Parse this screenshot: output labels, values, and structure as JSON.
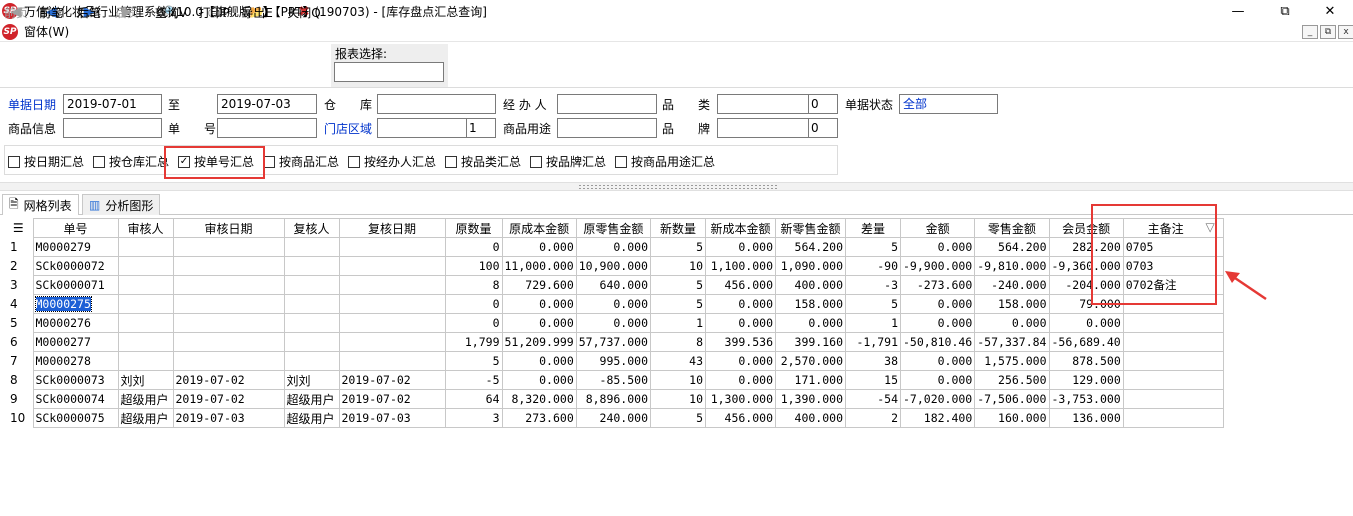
{
  "window": {
    "title": "万信达化妆品行业管理系统V10.0【旗舰版:1】【PPT】(190703) - [库存盘点汇总查询]",
    "logo_text": "SP",
    "minimize": "—",
    "maximize": "⧉",
    "close": "✕"
  },
  "menu": {
    "label": "窗体(W)",
    "mdi_min": "_",
    "mdi_restore": "⧉",
    "mdi_close": "x"
  },
  "toolbar": {
    "buttons": [
      {
        "label": "前页",
        "icon": "first-page-icon",
        "glyph": "◀",
        "enabled": false
      },
      {
        "label": "前笔",
        "icon": "prev-record-icon",
        "glyph": "◀",
        "enabled": true
      },
      {
        "label": "后笔",
        "icon": "next-record-icon",
        "glyph": "▶",
        "enabled": true
      },
      {
        "label": "后页",
        "icon": "last-page-icon",
        "glyph": "▶",
        "enabled": false
      },
      {
        "label": "查询V",
        "icon": "query-icon",
        "glyph": "🔍",
        "enabled": true
      },
      {
        "label": "打印P",
        "icon": "print-icon",
        "glyph": "⎙",
        "enabled": true
      },
      {
        "label": "导出E",
        "icon": "export-icon",
        "glyph": "📂",
        "enabled": true
      },
      {
        "label": "关闭Q",
        "icon": "close-x-icon",
        "glyph": "✖",
        "enabled": true
      }
    ],
    "report_select_label": "报表选择:",
    "report_select_value": ""
  },
  "filters": {
    "date_label": "单据日期",
    "date_from": "2019-07-01",
    "to_label": "至",
    "date_to": "2019-07-03",
    "warehouse_label": "仓　　库",
    "warehouse_value": "",
    "operator_label": "经 办 人",
    "operator_value": "",
    "category_label": "品　　类",
    "category_value": "",
    "category_num": "0",
    "status_label": "单据状态",
    "status_value": "全部",
    "product_label": "商品信息",
    "product_value": "",
    "docno_label": "单　　号",
    "docno_value": "",
    "store_area_label": "门店区域",
    "store_area_value": "",
    "store_area_num": "1",
    "usage_label": "商品用途",
    "usage_value": "",
    "brand_label": "品　　牌",
    "brand_value": "",
    "brand_num": "0"
  },
  "summary_options": [
    {
      "label": "按日期汇总",
      "checked": false
    },
    {
      "label": "按仓库汇总",
      "checked": false
    },
    {
      "label": "按单号汇总",
      "checked": true
    },
    {
      "label": "按商品汇总",
      "checked": false
    },
    {
      "label": "按经办人汇总",
      "checked": false
    },
    {
      "label": "按品类汇总",
      "checked": false
    },
    {
      "label": "按品牌汇总",
      "checked": false
    },
    {
      "label": "按商品用途汇总",
      "checked": false
    }
  ],
  "tabs": [
    {
      "label": "网格列表",
      "active": true
    },
    {
      "label": "分析图形",
      "active": false
    }
  ],
  "grid": {
    "columns": [
      "单号",
      "审核人",
      "审核日期",
      "复核人",
      "复核日期",
      "原数量",
      "原成本金额",
      "原零售金额",
      "新数量",
      "新成本金额",
      "新零售金额",
      "差量",
      "金额",
      "零售金额",
      "会员金额",
      "主备注"
    ],
    "sort_indicator": "▽",
    "rows": [
      {
        "n": "1",
        "c": [
          "M0000279",
          "",
          "",
          "",
          "",
          "0",
          "0.000",
          "0.000",
          "5",
          "0.000",
          "564.200",
          "5",
          "0.000",
          "564.200",
          "282.200",
          "0705"
        ]
      },
      {
        "n": "2",
        "c": [
          "SCk0000072",
          "",
          "",
          "",
          "",
          "100",
          "11,000.000",
          "10,900.000",
          "10",
          "1,100.000",
          "1,090.000",
          "-90",
          "-9,900.000",
          "-9,810.000",
          "-9,360.000",
          "0703"
        ]
      },
      {
        "n": "3",
        "c": [
          "SCk0000071",
          "",
          "",
          "",
          "",
          "8",
          "729.600",
          "640.000",
          "5",
          "456.000",
          "400.000",
          "-3",
          "-273.600",
          "-240.000",
          "-204.000",
          "0702备注"
        ]
      },
      {
        "n": "4",
        "c": [
          "M0000275",
          "",
          "",
          "",
          "",
          "0",
          "0.000",
          "0.000",
          "5",
          "0.000",
          "158.000",
          "5",
          "0.000",
          "158.000",
          "79.000",
          ""
        ]
      },
      {
        "n": "5",
        "c": [
          "M0000276",
          "",
          "",
          "",
          "",
          "0",
          "0.000",
          "0.000",
          "1",
          "0.000",
          "0.000",
          "1",
          "0.000",
          "0.000",
          "0.000",
          ""
        ]
      },
      {
        "n": "6",
        "c": [
          "M0000277",
          "",
          "",
          "",
          "",
          "1,799",
          "51,209.999",
          "57,737.000",
          "8",
          "399.536",
          "399.160",
          "-1,791",
          "-50,810.46",
          "-57,337.84",
          "-56,689.40",
          ""
        ]
      },
      {
        "n": "7",
        "c": [
          "M0000278",
          "",
          "",
          "",
          "",
          "5",
          "0.000",
          "995.000",
          "43",
          "0.000",
          "2,570.000",
          "38",
          "0.000",
          "1,575.000",
          "878.500",
          ""
        ]
      },
      {
        "n": "8",
        "c": [
          "SCk0000073",
          "刘刘",
          "2019-07-02",
          "刘刘",
          "2019-07-02",
          "-5",
          "0.000",
          "-85.500",
          "10",
          "0.000",
          "171.000",
          "15",
          "0.000",
          "256.500",
          "129.000",
          ""
        ]
      },
      {
        "n": "9",
        "c": [
          "SCk0000074",
          "超级用户",
          "2019-07-02",
          "超级用户",
          "2019-07-02",
          "64",
          "8,320.000",
          "8,896.000",
          "10",
          "1,300.000",
          "1,390.000",
          "-54",
          "-7,020.000",
          "-7,506.000",
          "-3,753.000",
          ""
        ]
      },
      {
        "n": "10",
        "c": [
          "SCk0000075",
          "超级用户",
          "2019-07-03",
          "超级用户",
          "2019-07-03",
          "3",
          "273.600",
          "240.000",
          "5",
          "456.000",
          "400.000",
          "2",
          "182.400",
          "160.000",
          "136.000",
          ""
        ]
      }
    ],
    "selected_row": 3
  },
  "colors": {
    "highlight_red": "#e53935",
    "selection_blue": "#1c5fd6",
    "label_blue": "#0033cc"
  }
}
